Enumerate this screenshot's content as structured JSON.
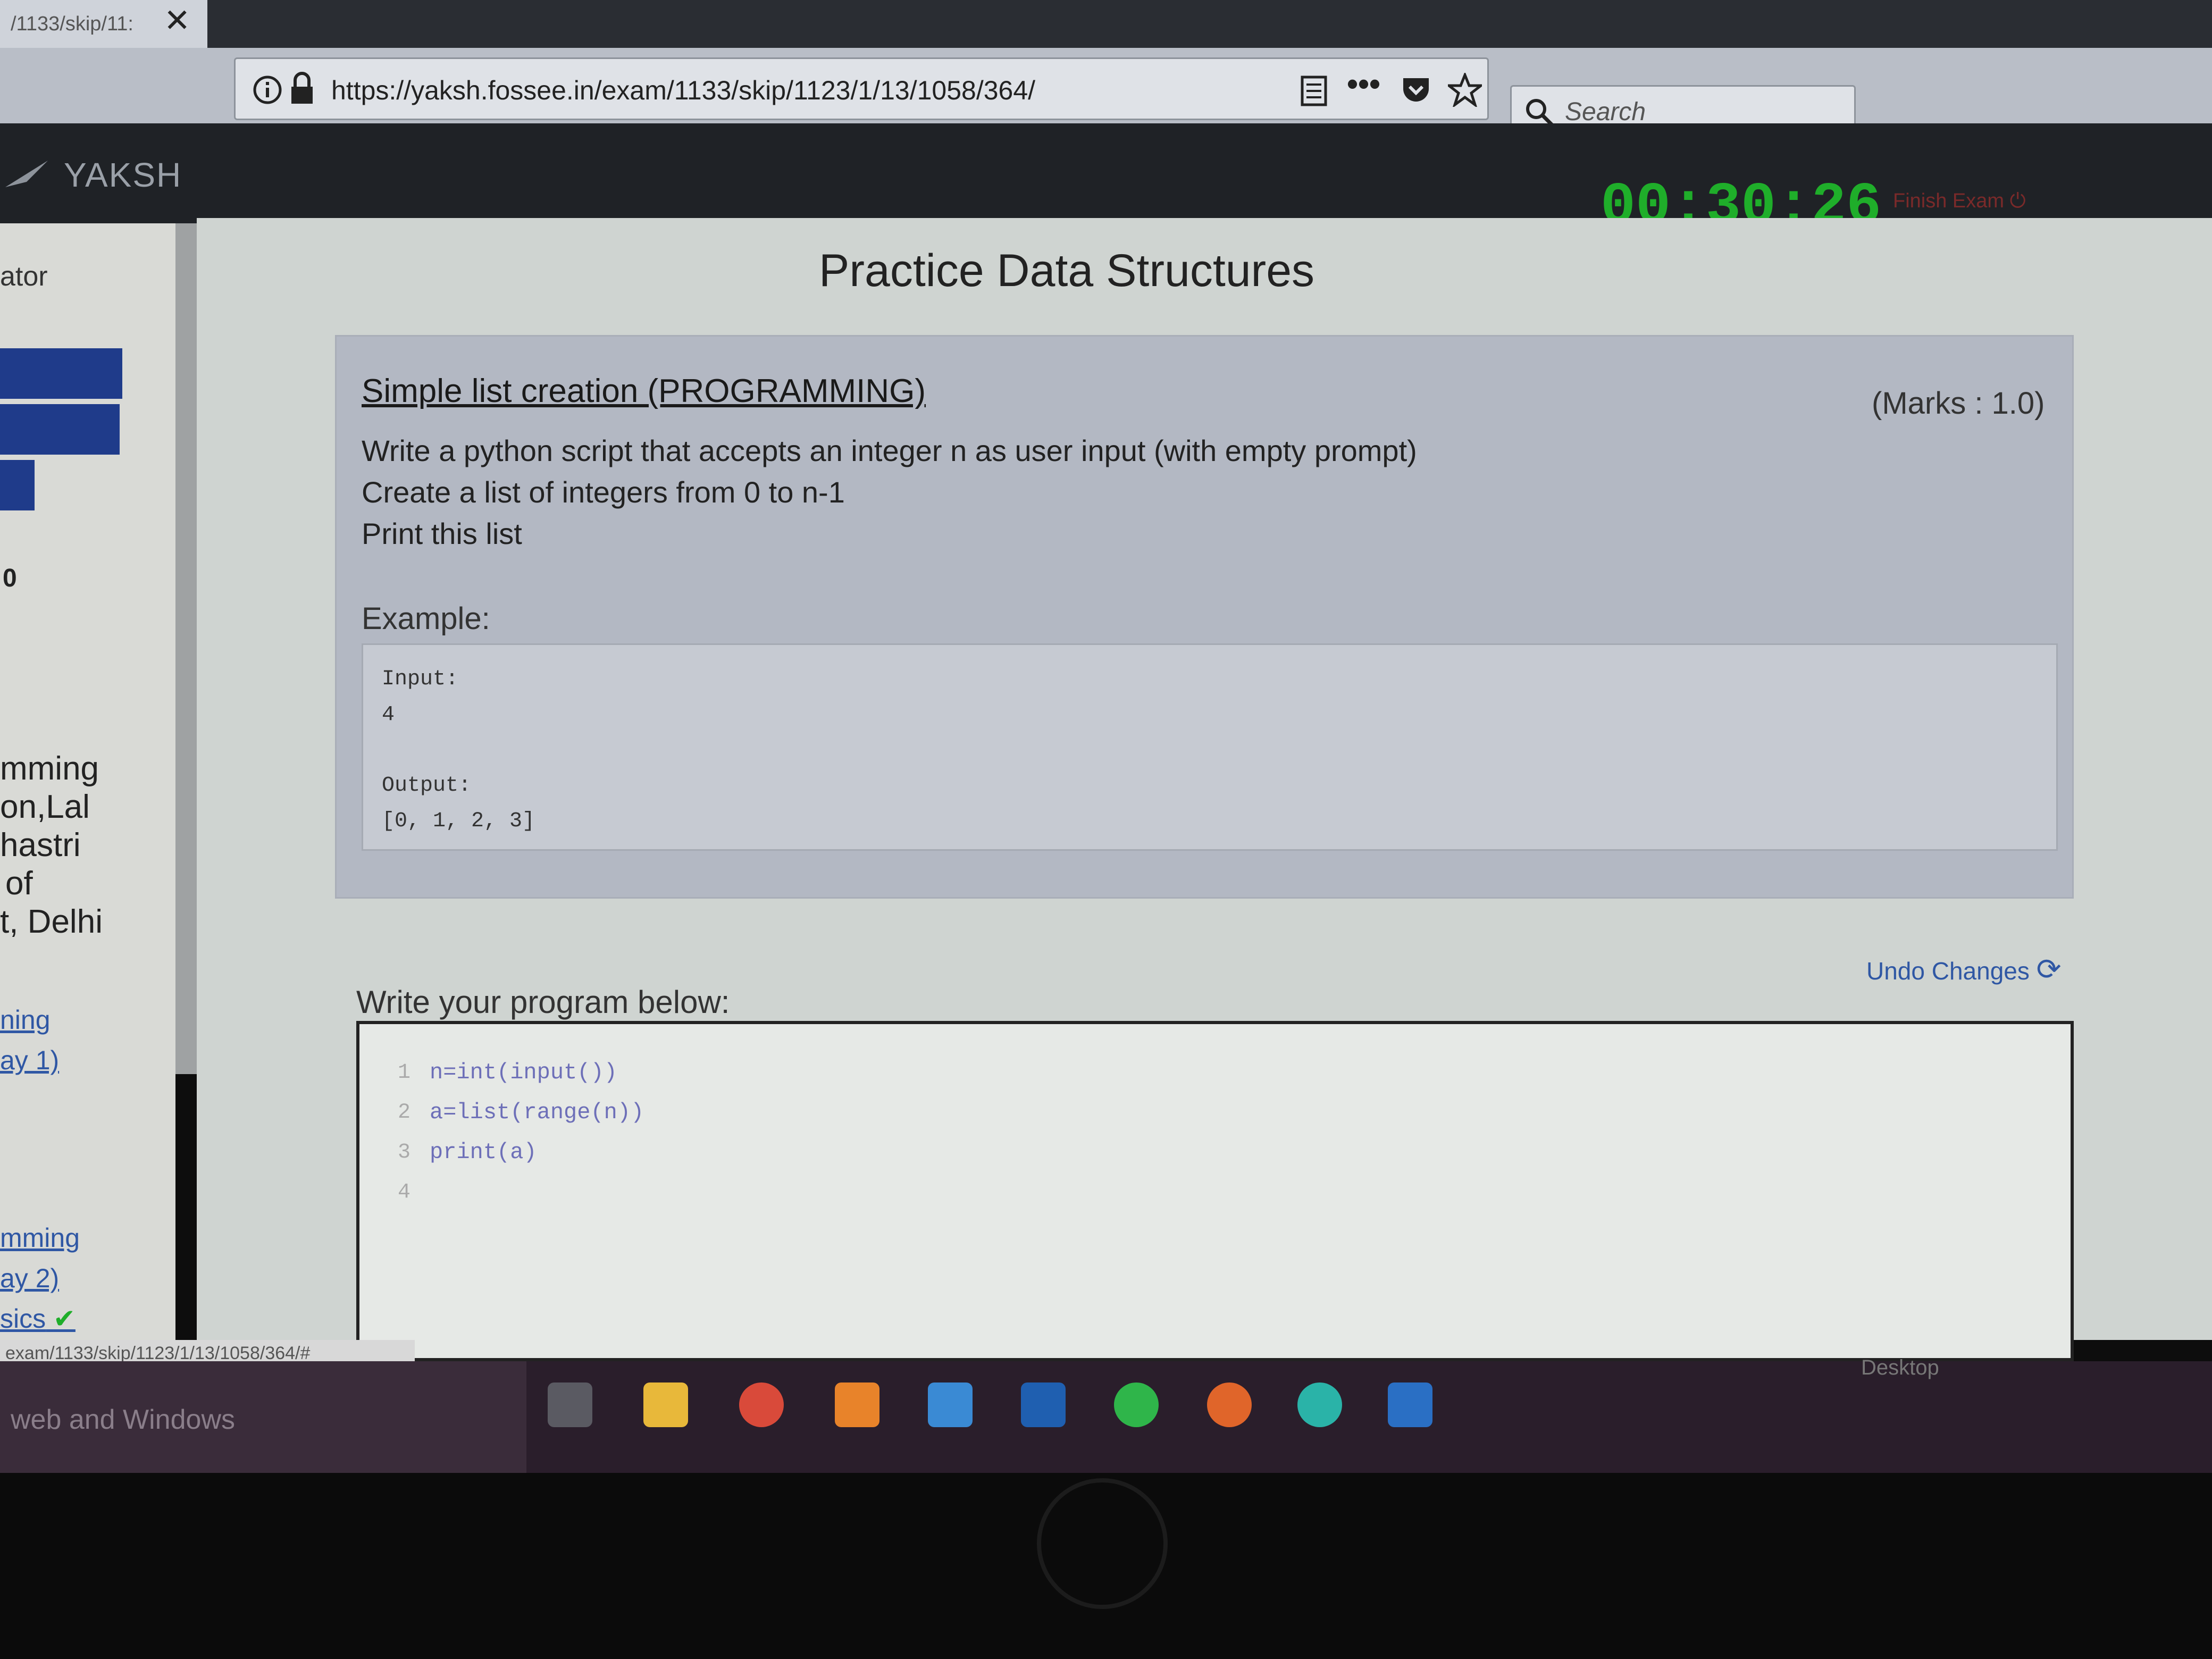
{
  "browser": {
    "tab_title": "/1133/skip/11:",
    "tab_close": "✕",
    "url": "https://yaksh.fossee.in/exam/1133/skip/1123/1/13/1058/364/",
    "search_placeholder": "Search",
    "overflow_menu": "•••"
  },
  "app": {
    "brand": "YAKSH",
    "timer": "00:30:26",
    "finish_exam": "Finish Exam"
  },
  "sidebar": {
    "header_fragment": "ator",
    "zero": "0",
    "course_fragments": [
      "mming",
      "on,Lal",
      "hastri",
      "of",
      "t, Delhi"
    ],
    "links": [
      "ning",
      "ay 1)",
      "mming",
      "ay 2)",
      "sics"
    ],
    "done_mark": "✔"
  },
  "page": {
    "title": "Practice Data Structures",
    "question": {
      "title": "Simple list creation (PROGRAMMING)",
      "marks": "(Marks : 1.0)",
      "lines": [
        "Write a python script that accepts an integer n as user input (with empty prompt)",
        "Create a list of integers from 0 to n-1",
        "Print this list"
      ],
      "example_label": "Example:",
      "example": {
        "input_label": "Input:",
        "input_value": "4",
        "output_label": "Output:",
        "output_value": "[0, 1, 2, 3]"
      }
    },
    "write_label": "Write your program below:",
    "undo_label": "Undo Changes",
    "code_lines": [
      {
        "n": "1",
        "code": "n=int(input())"
      },
      {
        "n": "2",
        "code": "a=list(range(n))"
      },
      {
        "n": "3",
        "code": "print(a)"
      },
      {
        "n": "4",
        "code": ""
      }
    ]
  },
  "status_url": "exam/1133/skip/1123/1/13/1058/364/#",
  "taskbar": {
    "search_text": "web and Windows",
    "desktop_label": "Desktop",
    "apps": [
      "task-view",
      "file-explorer",
      "chrome",
      "vlc",
      "media-player",
      "powershell",
      "whatsapp",
      "firefox",
      "edge-globe",
      "app-window"
    ]
  },
  "colors": {
    "timer": "#1fae2a",
    "link": "#2f57a4",
    "code": "#6d6fb8"
  }
}
